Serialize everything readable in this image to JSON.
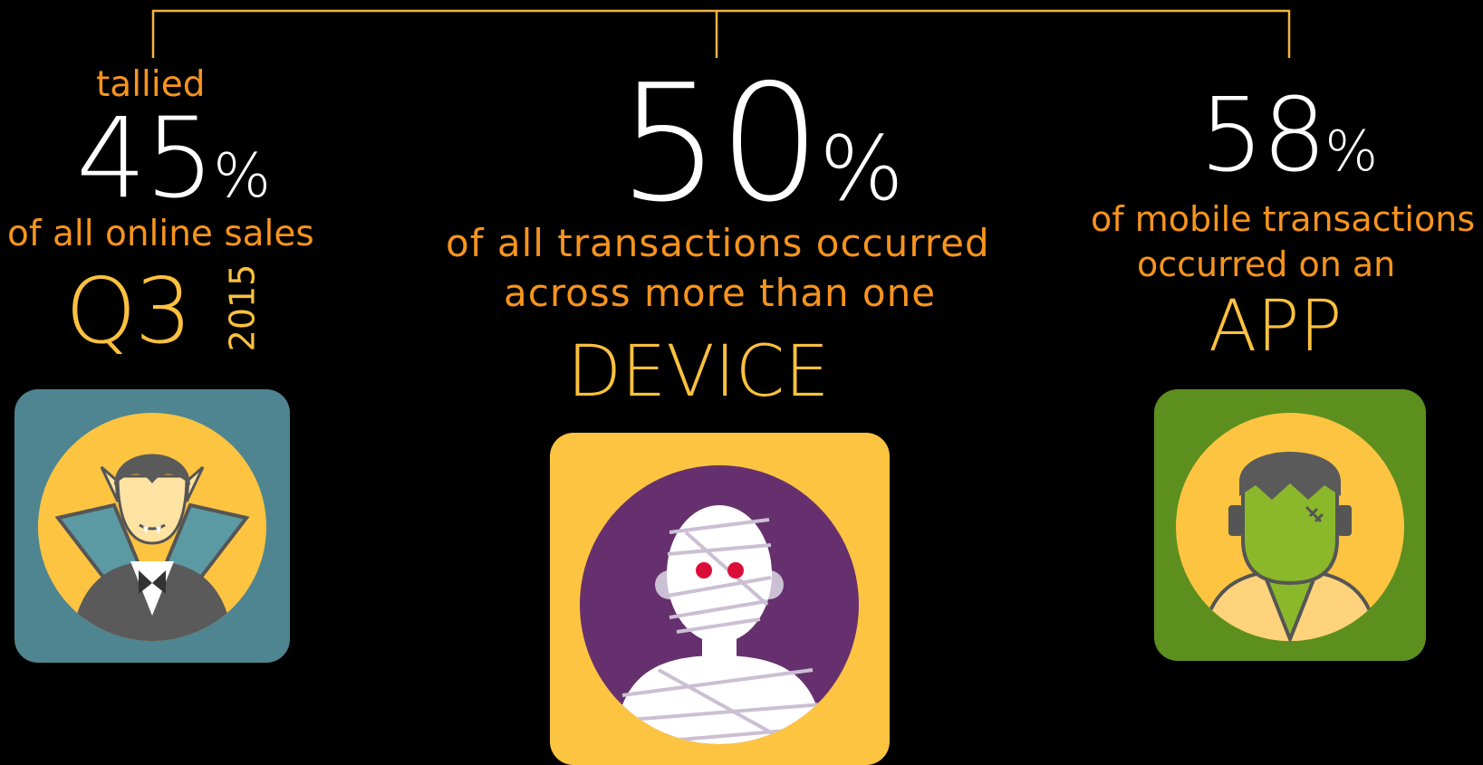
{
  "left": {
    "pre_label": "tallied",
    "percent_value": "45",
    "percent_sign": "%",
    "description": "of all online sales",
    "quarter": "Q3",
    "year": "2015",
    "icon": "vampire-icon"
  },
  "center": {
    "percent_value": "50",
    "percent_sign": "%",
    "description_line1": "of all transactions occurred",
    "description_line2": "across more than one",
    "keyword": "DEVICE",
    "icon": "mummy-icon"
  },
  "right": {
    "percent_value": "58",
    "percent_sign": "%",
    "description_line1": "of mobile transactions",
    "description_line2": "occurred on an",
    "keyword": "APP",
    "icon": "frankenstein-icon"
  },
  "colors": {
    "background": "#000000",
    "orange_text": "#F7941D",
    "gold_text": "#FBC13E",
    "line": "#F2B441",
    "teal_card": "#4E8590",
    "yellow_card": "#FDC441",
    "green_card": "#5D8F1E",
    "purple_circle": "#66306E"
  }
}
